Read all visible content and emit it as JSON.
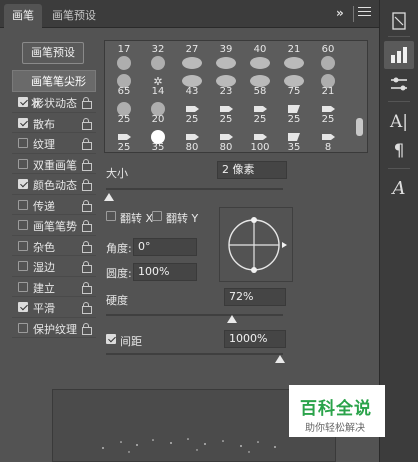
{
  "tabs": {
    "active": "画笔",
    "inactive": "画笔预设",
    "close": "×",
    "expand": "»"
  },
  "preset_button": "画笔预设",
  "options_list": {
    "header": "画笔笔尖形状",
    "items": [
      {
        "label": "形状动态",
        "checked": true,
        "locked": true
      },
      {
        "label": "散布",
        "checked": true,
        "locked": true
      },
      {
        "label": "纹理",
        "checked": false,
        "locked": true
      },
      {
        "label": "双重画笔",
        "checked": false,
        "locked": true
      },
      {
        "label": "颜色动态",
        "checked": true,
        "locked": true
      },
      {
        "label": "传递",
        "checked": false,
        "locked": true
      },
      {
        "label": "画笔笔势",
        "checked": false,
        "locked": true
      },
      {
        "label": "杂色",
        "checked": false,
        "locked": true
      },
      {
        "label": "湿边",
        "checked": false,
        "locked": true
      },
      {
        "label": "建立",
        "checked": false,
        "locked": true
      },
      {
        "label": "平滑",
        "checked": true,
        "locked": true
      },
      {
        "label": "保护纹理",
        "checked": false,
        "locked": true
      }
    ]
  },
  "brush_tips": {
    "rows": [
      [
        "17",
        "32",
        "27",
        "39",
        "40",
        "21",
        "60"
      ],
      [
        "65",
        "14",
        "43",
        "23",
        "58",
        "75",
        "21"
      ],
      [
        "25",
        "20",
        "25",
        "25",
        "25",
        "25",
        "25"
      ],
      [
        "25",
        "35",
        "80",
        "80",
        "100",
        "35",
        "8"
      ]
    ]
  },
  "size": {
    "label": "大小",
    "value": "2 像素",
    "fraction": 0.0
  },
  "flip_x": {
    "label": "翻转 X",
    "checked": false
  },
  "flip_y": {
    "label": "翻转 Y",
    "checked": false
  },
  "angle": {
    "label": "角度:",
    "value": "0°"
  },
  "roundness": {
    "label": "圆度:",
    "value": "100%"
  },
  "hardness": {
    "label": "硬度",
    "value": "72%",
    "fraction": 0.72
  },
  "spacing": {
    "label": "间距",
    "value": "1000%",
    "checked": true,
    "fraction": 1.0
  },
  "watermark": {
    "main": "百科全说",
    "sub": "助你轻松解决"
  },
  "dock": {
    "items": [
      "history-icon",
      "brush-icon",
      "adjust-icon",
      "character-icon",
      "paragraph-icon",
      "glyph-icon"
    ],
    "labels": {
      "character": "A|",
      "paragraph": "¶",
      "glyph": "A"
    }
  },
  "colors": {
    "panel_bg": "#535353",
    "tab_bar": "#3c3c3c",
    "accent_text": "#e6e6e6",
    "watermark_green": "#2aa34a"
  }
}
